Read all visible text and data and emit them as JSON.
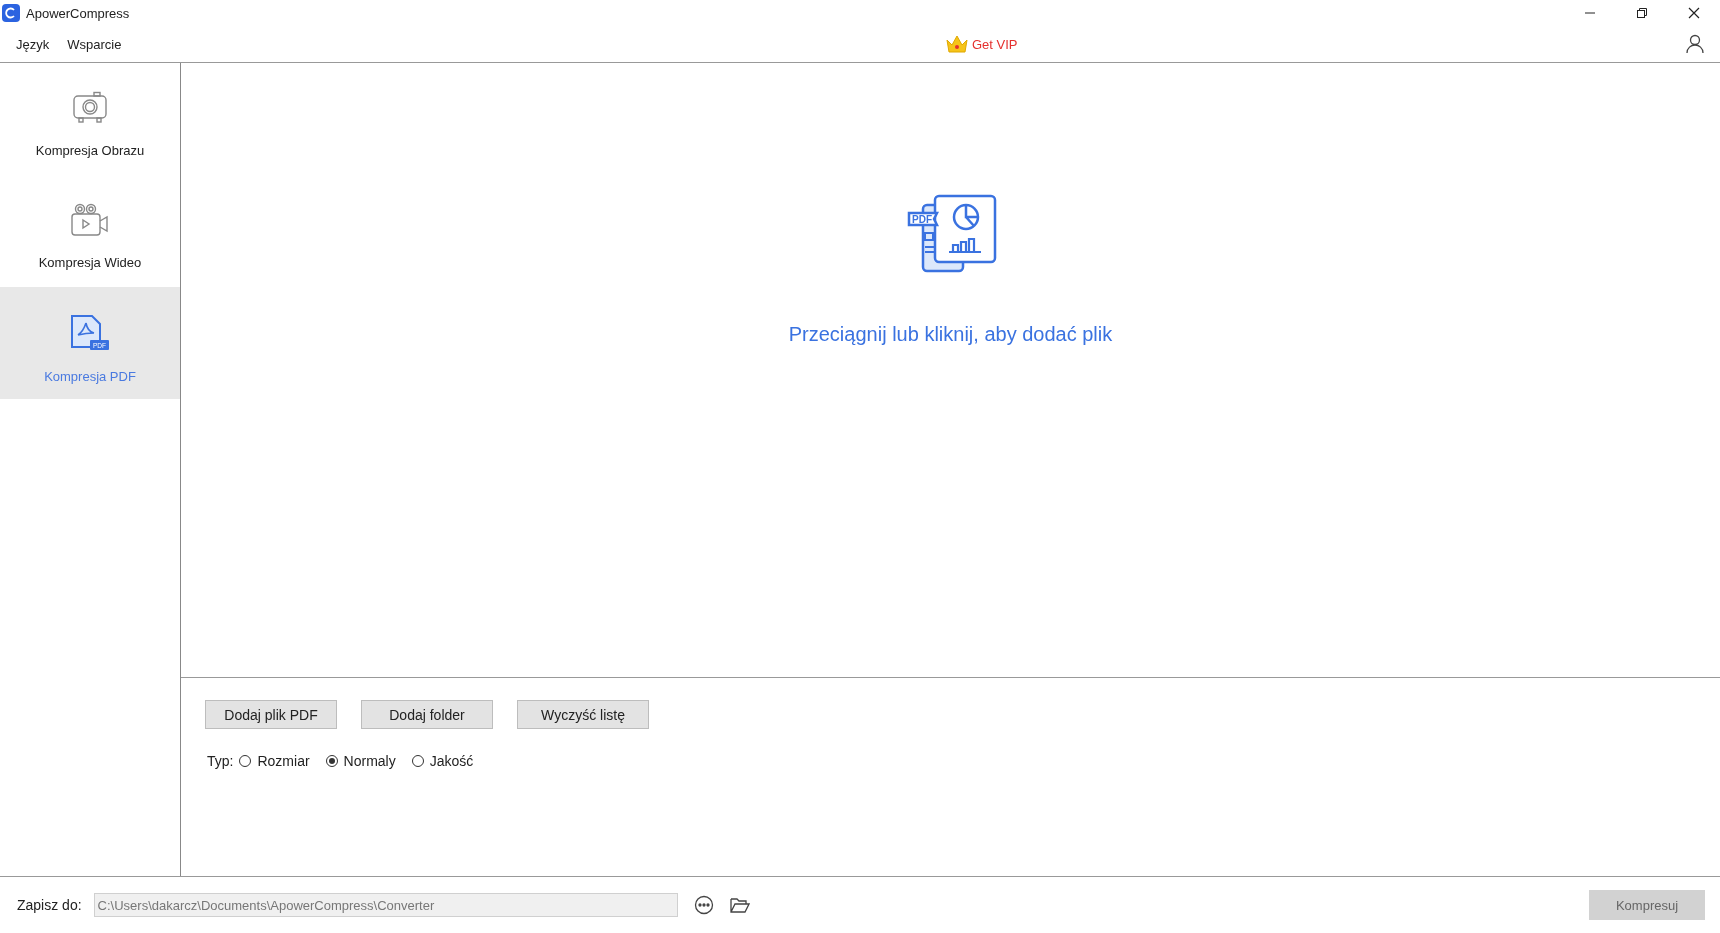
{
  "window": {
    "title": "ApowerCompress"
  },
  "menu": [
    {
      "label": "Język"
    },
    {
      "label": "Wsparcie"
    }
  ],
  "vip": {
    "label": "Get VIP"
  },
  "sidebar": {
    "items": [
      {
        "kind": "image",
        "label": "Kompresja Obrazu",
        "selected": false
      },
      {
        "kind": "video",
        "label": "Kompresja Wideo",
        "selected": false
      },
      {
        "kind": "pdf",
        "label": "Kompresja PDF",
        "selected": true,
        "badge": "PDF"
      }
    ]
  },
  "drop_zone": {
    "badge": "PDF",
    "text": "Przeciągnij lub kliknij, aby dodać plik"
  },
  "buttons": [
    {
      "label": "Dodaj plik PDF"
    },
    {
      "label": "Dodaj folder"
    },
    {
      "label": "Wyczyść listę"
    }
  ],
  "type": {
    "label": "Typ:",
    "options": [
      {
        "label": "Rozmiar",
        "selected": false
      },
      {
        "label": "Normaly",
        "selected": true
      },
      {
        "label": "Jakość",
        "selected": false
      }
    ]
  },
  "footer": {
    "label": "Zapisz do:",
    "path": "C:\\Users\\dakarcz\\Documents\\ApowerCompress\\Converter",
    "compress": {
      "label": "Kompresuj",
      "disabled": true
    }
  }
}
